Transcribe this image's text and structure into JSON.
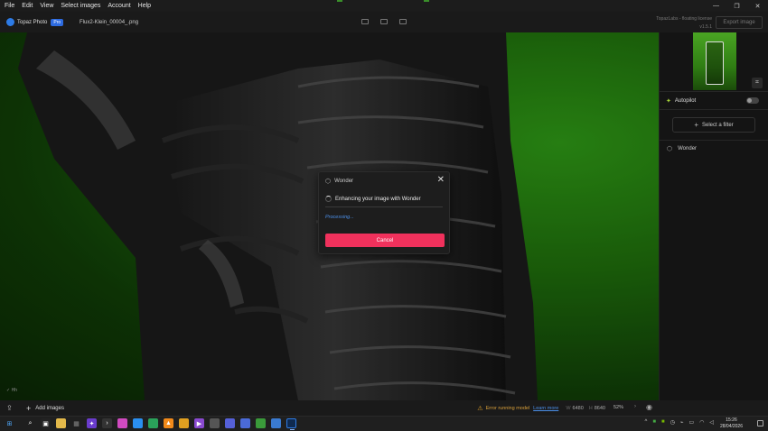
{
  "menu": {
    "items": [
      "File",
      "Edit",
      "View",
      "Select images",
      "Account",
      "Help"
    ]
  },
  "window_controls": {
    "minimize": "—",
    "maximize": "❐",
    "close": "✕"
  },
  "header": {
    "app_name": "Topaz Photo",
    "badge": "Pro",
    "filename": "Flux2-Klein_00004_.png",
    "license_line1": "TopazLabs - floating license",
    "license_line2": "v1.5.1",
    "export_label": "Export image"
  },
  "canvas": {
    "mini_note": "Hh"
  },
  "right_panel": {
    "autopilot_label": "Autopilot",
    "select_filter_label": "Select a filter",
    "filter_name": "Wonder",
    "autopilot_enabled": false
  },
  "modal": {
    "title": "Wonder",
    "status": "Enhancing your image with Wonder",
    "processing": "Processing...",
    "cancel_label": "Cancel",
    "progress": 0
  },
  "status_bar": {
    "add_images_label": "Add images",
    "error_text": "Error running model",
    "learn_more": "Learn more",
    "width_label": "W",
    "width": "6480",
    "height_label": "H",
    "height": "8640",
    "zoom": "52%"
  },
  "taskbar": {
    "time": "15:26",
    "date": "28/04/2026"
  },
  "colors": {
    "accent": "#f0315c",
    "link": "#4b8fe8",
    "warning": "#d9a03a",
    "brand": "#2d7be6"
  }
}
